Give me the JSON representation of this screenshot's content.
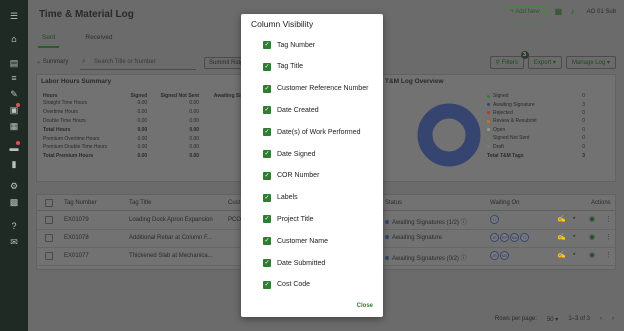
{
  "sidebar": {
    "icons": [
      "menu-icon",
      "home-icon",
      "document-icon",
      "list-icon",
      "pencil-icon",
      "clipboard-icon",
      "stack-icon",
      "gear-icon",
      "chart-icon",
      "settings-icon",
      "grid-icon",
      "help-icon",
      "chat-icon"
    ]
  },
  "header": {
    "title": "Time & Material Log",
    "add_new_label": "+ Add New",
    "subscription_label": "AO 01 Sub"
  },
  "tabs": [
    "Sent",
    "Received"
  ],
  "toolbar": {
    "summary_label": "Summary",
    "search_placeholder": "Search Title or Number",
    "filter_chip": "Summit Ridge Co",
    "filters_label": "Filters",
    "filters_count": "3",
    "export_label": "Export",
    "manage_log_label": "Manage Log"
  },
  "labor_summary": {
    "title": "Labor Hours Summary",
    "columns": [
      "Hours",
      "Signed",
      "Signed Not Sent",
      "Awaiting Signature"
    ],
    "rows": [
      {
        "label": "Straight Time Hours",
        "values": [
          "0.00",
          "0.00",
          "202.0"
        ],
        "bold": false
      },
      {
        "label": "Overtime Hours",
        "values": [
          "0.00",
          "0.00",
          "0.00"
        ],
        "bold": false
      },
      {
        "label": "Double Time Hours",
        "values": [
          "0.00",
          "0.00",
          "0.00"
        ],
        "bold": false
      },
      {
        "label": "Total Hours",
        "values": [
          "0.00",
          "0.00",
          "202.0"
        ],
        "bold": true
      },
      {
        "label": "Premium Overtime Hours",
        "values": [
          "0.00",
          "0.00",
          "0.00"
        ],
        "bold": false
      },
      {
        "label": "Premium Double Time Hours",
        "values": [
          "0.00",
          "0.00",
          "0.00"
        ],
        "bold": false
      },
      {
        "label": "Total Premium Hours",
        "values": [
          "0.00",
          "0.00",
          "0.00"
        ],
        "bold": true
      }
    ]
  },
  "overview": {
    "title": "T&M Log Overview",
    "legend": [
      {
        "label": "Signed",
        "count": "0",
        "color": "#2f7d32"
      },
      {
        "label": "Awaiting Signature",
        "count": "3",
        "color": "#35456f"
      },
      {
        "label": "Rejected",
        "count": "0",
        "color": "#b03a2e"
      },
      {
        "label": "Review & Resubmit",
        "count": "0",
        "color": "#c47a1b"
      },
      {
        "label": "Open",
        "count": "0",
        "color": "#9a9a9a"
      },
      {
        "label": "Signed Not Sent",
        "count": "0",
        "color": "#5a8a5a"
      },
      {
        "label": "Draft",
        "count": "0",
        "color": "#7a7a7a"
      }
    ],
    "total_label": "Total T&M Tags",
    "total_count": "3",
    "donut_color": "#35456f"
  },
  "grid": {
    "columns": {
      "tag_number": "Tag Number",
      "tag_title": "Tag Title",
      "customer": "Cust",
      "status": "Status",
      "waiting_on": "Waiting On",
      "actions": "Actions"
    },
    "rows": [
      {
        "tag_number": "EX01079",
        "tag_title": "Loading Dock Apron Expansion",
        "customer": "PCO",
        "status": "Awaiting Signatures (1/2)",
        "avatars": [
          "TJ"
        ]
      },
      {
        "tag_number": "EX01078",
        "tag_title": "Additional Rebar at Column F...",
        "customer": "",
        "status": "Awaiting Signature",
        "avatars": [
          "JR",
          "KP",
          "MA",
          "TJ"
        ]
      },
      {
        "tag_number": "EX01077",
        "tag_title": "Thickened Slab at Mechanica...",
        "customer": "",
        "status": "Awaiting Signatures (0/2)",
        "avatars": [
          "JR",
          "MA"
        ]
      }
    ]
  },
  "footer": {
    "rows_per_page_label": "Rows per page:",
    "rows_per_page_value": "50",
    "range_label": "1–3 of 3"
  },
  "modal": {
    "title": "Column Visibility",
    "options": [
      "Tag Number",
      "Tag Title",
      "Customer Reference Number",
      "Date Created",
      "Date(s) of Work Performed",
      "Date Signed",
      "COR Number",
      "Labels",
      "Project Title",
      "Customer Name",
      "Date Submitted",
      "Cost Code"
    ],
    "close_label": "Close"
  }
}
